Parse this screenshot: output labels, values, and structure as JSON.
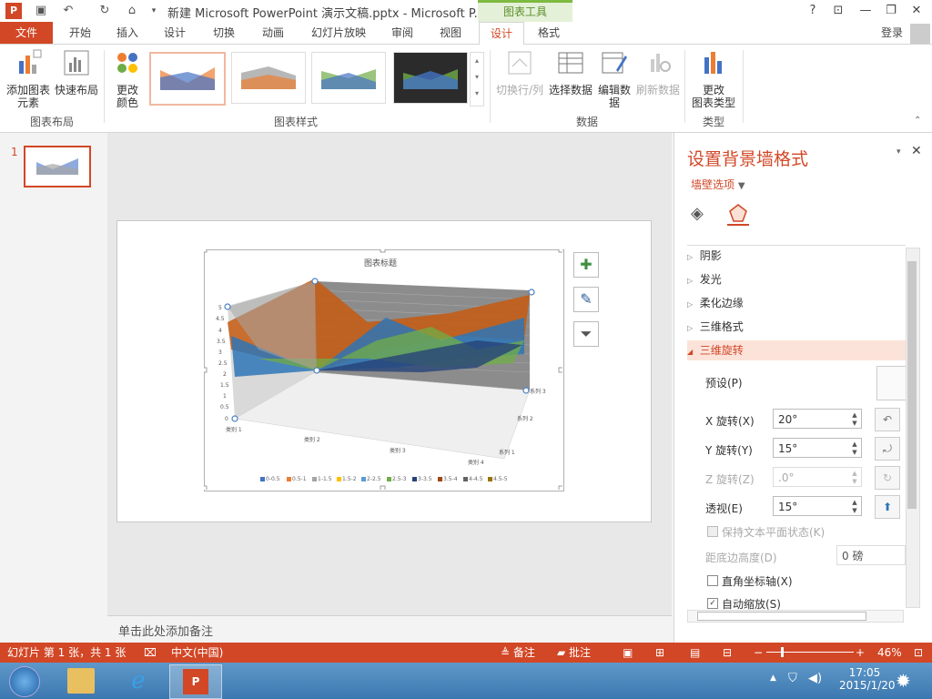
{
  "window": {
    "title": "新建 Microsoft PowerPoint 演示文稿.pptx - Microsoft P...",
    "contextual_tab": "图表工具",
    "help": "?",
    "signin": "登录"
  },
  "tabs": [
    {
      "label": "文件"
    },
    {
      "label": "开始"
    },
    {
      "label": "插入"
    },
    {
      "label": "设计"
    },
    {
      "label": "切换"
    },
    {
      "label": "动画"
    },
    {
      "label": "幻灯片放映"
    },
    {
      "label": "审阅"
    },
    {
      "label": "视图"
    },
    {
      "label": "设计"
    },
    {
      "label": "格式"
    }
  ],
  "ribbon": {
    "add_element": "添加图表",
    "add_element2": "元素",
    "quick_layout": "快速布局",
    "group_layout": "图表布局",
    "change_color": "更改",
    "change_color2": "颜色",
    "group_styles": "图表样式",
    "switch_rowcol": "切换行/列",
    "select_data": "选择数据",
    "edit_data": "编辑数",
    "edit_data2": "据",
    "refresh_data": "刷新数据",
    "group_data": "数据",
    "change_type": "更改",
    "change_type2": "图表类型",
    "group_type": "类型"
  },
  "slide_thumb": {
    "number": "1"
  },
  "chart_data": {
    "type": "area",
    "title": "图表标题",
    "categories": [
      "类别 1",
      "类别 2",
      "类别 3",
      "类别 4"
    ],
    "series_axis": [
      "系列 1",
      "系列 2",
      "系列 3"
    ],
    "y_ticks": [
      "0",
      "0.5",
      "1",
      "1.5",
      "2",
      "2.5",
      "3",
      "3.5",
      "4",
      "4.5",
      "5"
    ],
    "ylim": [
      0,
      5
    ],
    "legend": [
      "0-0.5",
      "0.5-1",
      "1-1.5",
      "1.5-2",
      "2-2.5",
      "2.5-3",
      "3-3.5",
      "3.5-4",
      "4-4.5",
      "4.5-5"
    ],
    "legend_colors": [
      "#4472c4",
      "#ed7d31",
      "#a5a5a5",
      "#ffc000",
      "#5b9bd5",
      "#70ad47",
      "#264478",
      "#9e480e",
      "#636363",
      "#997300"
    ]
  },
  "notes": {
    "placeholder": "单击此处添加备注"
  },
  "pane": {
    "title": "设置背景墙格式",
    "options": "墙壁选项",
    "sections": [
      "阴影",
      "发光",
      "柔化边缘",
      "三维格式",
      "三维旋转"
    ],
    "preset_label": "预设(P)",
    "x_label": "X 旋转(X)",
    "x_value": "20°",
    "y_label": "Y 旋转(Y)",
    "y_value": "15°",
    "z_label": "Z 旋转(Z)",
    "z_value": ".0°",
    "persp_label": "透视(E)",
    "persp_value": "15°",
    "keep_text": "保持文本平面状态(K)",
    "bottom_dist": "距底边高度(D)",
    "bottom_value": "0 磅",
    "right_angle": "直角坐标轴(X)",
    "autoscale": "自动缩放(S)"
  },
  "status": {
    "slide_info": "幻灯片 第 1 张，共 1 张",
    "language": "中文(中国)",
    "notes": "备注",
    "comments": "批注",
    "zoom": "46%"
  },
  "taskbar": {
    "time": "17:05",
    "date": "2015/1/20"
  },
  "colors": {
    "accent": "#d24726",
    "ribbon_bg": "#ffffff"
  }
}
